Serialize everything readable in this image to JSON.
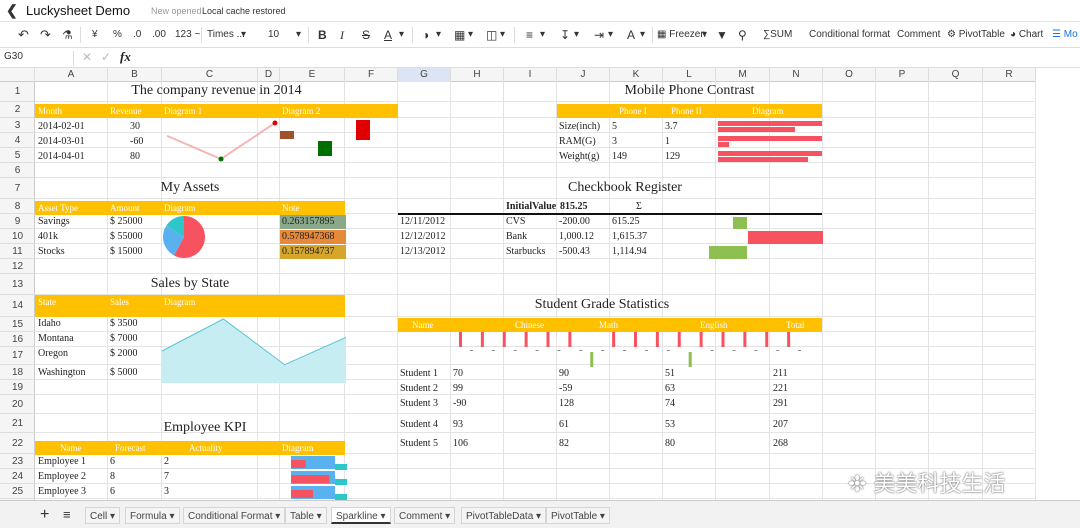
{
  "app": {
    "title": "Luckysheet Demo",
    "status_new": "New opened",
    "status_cache": "Local cache restored"
  },
  "toolbar": {
    "font": "Times ...",
    "font_size": "10",
    "number_format": "123 ~",
    "percent": "%",
    "currency": "¥",
    "dec_less": ".0",
    "dec_more": ".00",
    "freeze": "Freezen",
    "sum": "SUM",
    "conditional_format": "Conditional format",
    "comment": "Comment",
    "pivot": "PivotTable",
    "chart": "Chart",
    "more": "Mo"
  },
  "formula_bar": {
    "cell_ref": "G30",
    "fx": "fx"
  },
  "columns": [
    "A",
    "B",
    "C",
    "D",
    "E",
    "F",
    "G",
    "H",
    "I",
    "J",
    "K",
    "L",
    "M",
    "N",
    "O",
    "P",
    "Q",
    "R"
  ],
  "rows": [
    "1",
    "2",
    "3",
    "4",
    "5",
    "6",
    "7",
    "8",
    "9",
    "10",
    "11",
    "12",
    "13",
    "14",
    "15",
    "16",
    "17",
    "18",
    "19",
    "20",
    "21",
    "22",
    "23",
    "24",
    "25"
  ],
  "revenue": {
    "title": "The company revenue in 2014",
    "headers": [
      "Month",
      "Revenue",
      "Diagram 1",
      "Diagram 2"
    ],
    "rows": [
      [
        "2014-02-01",
        "30"
      ],
      [
        "2014-03-01",
        "-60"
      ],
      [
        "2014-04-01",
        "80"
      ]
    ],
    "colors": {
      "line": "#f4b6b6",
      "bar_pos": "#e00000",
      "bar_neg": "#a0522d",
      "bar3": "#007000"
    }
  },
  "phone": {
    "title": "Mobile Phone Contrast",
    "headers": [
      "Phone I",
      "Phone II",
      "Diagram"
    ],
    "rows": [
      [
        "Size(inch)",
        "5",
        "3.7"
      ],
      [
        "RAM(G)",
        "3",
        "1"
      ],
      [
        "Weight(g)",
        "149",
        "129"
      ]
    ]
  },
  "assets": {
    "title": "My Assets",
    "headers": [
      "Asset Type",
      "Amount",
      "Diagram",
      "Note"
    ],
    "rows": [
      [
        "Savings",
        "$ 25000",
        "0.263157895"
      ],
      [
        "401k",
        "$ 55000",
        "0.578947368"
      ],
      [
        "Stocks",
        "$ 15000",
        "0.157894737"
      ]
    ],
    "pie_colors": [
      "#f7525f",
      "#5ab1ef",
      "#2ec7c9"
    ],
    "note_colors": [
      "#8aa88a",
      "#e68a3a",
      "#d6a62a"
    ]
  },
  "checkbook": {
    "title": "Checkbook Register",
    "initial_label": "InitialValue",
    "initial_value": "815.25",
    "sigma": "Σ",
    "rows": [
      [
        "12/11/2012",
        "CVS",
        "-200.00",
        "615.25"
      ],
      [
        "12/12/2012",
        "Bank",
        "1,000.12",
        "1,615.37"
      ],
      [
        "12/13/2012",
        "Starbucks",
        "-500.43",
        "1,114.94"
      ]
    ],
    "colors": {
      "pos": "#f7525f",
      "neg": "#8dc050",
      "small": "#8dc050"
    }
  },
  "sales": {
    "title": "Sales by State",
    "headers": [
      "State",
      "Sales",
      "Diagram"
    ],
    "rows": [
      [
        "Idaho",
        "$ 3500"
      ],
      [
        "Montana",
        "$ 7000"
      ],
      [
        "Oregon",
        "$ 2000"
      ],
      [
        "Washington",
        "$ 5000"
      ]
    ],
    "area_color": "#c6eef2",
    "line_color": "#5bc3d2"
  },
  "grades": {
    "title": "Student Grade Statistics",
    "headers": [
      "Name",
      "Chinese",
      "Math",
      "English",
      "Total"
    ],
    "rows": [
      [
        "Student 1",
        "70",
        "90",
        "51",
        "211"
      ],
      [
        "Student 2",
        "99",
        "-59",
        "63",
        "221"
      ],
      [
        "Student 3",
        "-90",
        "128",
        "74",
        "291"
      ],
      [
        "Student 4",
        "93",
        "61",
        "53",
        "207"
      ],
      [
        "Student 5",
        "106",
        "82",
        "80",
        "268"
      ]
    ]
  },
  "kpi": {
    "title": "Employee KPI",
    "headers": [
      "Name",
      "Forecast",
      "Actuality",
      "Diagram"
    ],
    "rows": [
      [
        "Employee 1",
        "6",
        "2"
      ],
      [
        "Employee 2",
        "8",
        "7"
      ],
      [
        "Employee 3",
        "6",
        "3"
      ]
    ]
  },
  "sheet_tabs": [
    "Cell",
    "Formula",
    "Conditional Format",
    "Table",
    "Sparkline",
    "Comment",
    "PivotTableData",
    "PivotTable"
  ],
  "active_tab": "Sparkline",
  "watermark": "美美科技生活",
  "colors": {
    "header_yellow": "#ffc000",
    "accent_blue": "#1a73e8"
  }
}
